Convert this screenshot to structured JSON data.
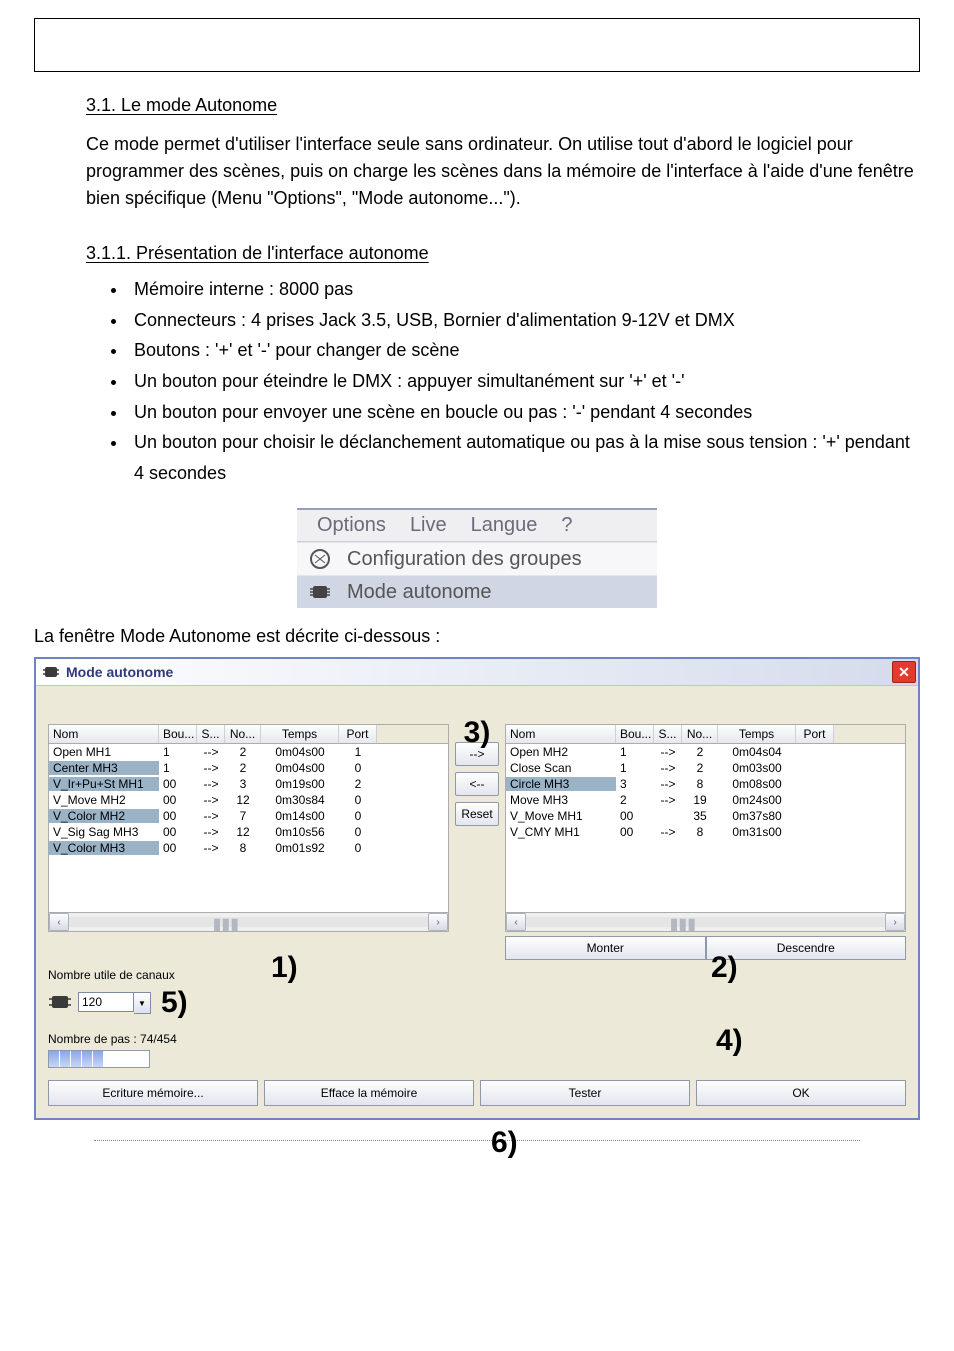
{
  "text": {
    "heading1": "3.1. Le mode Autonome",
    "para1": "Ce mode permet d'utiliser l'interface seule sans ordinateur. On utilise tout d'abord le logiciel pour programmer des scènes, puis on charge les scènes dans la mémoire de l'interface à l'aide d'une fenêtre bien spécifique (Menu \"Options\", \"Mode autonome...\").",
    "heading2": "3.1.1. Présentation de l'interface autonome",
    "li1": "Mémoire interne : 8000 pas",
    "li2": "Connecteurs : 4 prises Jack 3.5, USB, Bornier d'alimentation 9-12V et DMX",
    "li3": "Boutons : '+' et '-' pour changer de scène",
    "li4": "Un bouton pour éteindre le DMX : appuyer simultanément sur '+' et '-'",
    "li5": "Un bouton pour envoyer une scène en boucle ou pas : '-' pendant 4 secondes",
    "li6": "Un bouton pour choisir le déclanchement automatique ou pas à la mise sous tension : '+' pendant 4 secondes"
  },
  "menu": {
    "items": [
      "Options",
      "Live",
      "Langue",
      "?"
    ],
    "entry1": "Configuration des groupes",
    "entry2": "Mode autonome"
  },
  "caption": "La fenêtre Mode Autonome est décrite ci-dessous :",
  "window": {
    "title": "Mode autonome",
    "closeGlyph": "✕",
    "headers": [
      "Nom",
      "Bou...",
      "S...",
      "No...",
      "Temps",
      "Port"
    ],
    "leftRows": [
      {
        "nom": "Open MH1",
        "bou": "1",
        "s": "-->",
        "no": "2",
        "temps": "0m04s00",
        "port": "1",
        "sel": false
      },
      {
        "nom": "Center MH3",
        "bou": "1",
        "s": "-->",
        "no": "2",
        "temps": "0m04s00",
        "port": "0",
        "sel": true
      },
      {
        "nom": "V_Ir+Pu+St MH1",
        "bou": "00",
        "s": "-->",
        "no": "3",
        "temps": "0m19s00",
        "port": "2",
        "sel": true
      },
      {
        "nom": "V_Move MH2",
        "bou": "00",
        "s": "-->",
        "no": "12",
        "temps": "0m30s84",
        "port": "0",
        "sel": false
      },
      {
        "nom": "V_Color MH2",
        "bou": "00",
        "s": "-->",
        "no": "7",
        "temps": "0m14s00",
        "port": "0",
        "sel": true
      },
      {
        "nom": "V_Sig Sag MH3",
        "bou": "00",
        "s": "-->",
        "no": "12",
        "temps": "0m10s56",
        "port": "0",
        "sel": false
      },
      {
        "nom": "V_Color MH3",
        "bou": "00",
        "s": "-->",
        "no": "8",
        "temps": "0m01s92",
        "port": "0",
        "sel": true
      }
    ],
    "rightRows": [
      {
        "nom": "Open MH2",
        "bou": "1",
        "s": "-->",
        "no": "2",
        "temps": "0m04s04",
        "port": "",
        "sel": false
      },
      {
        "nom": "Close Scan",
        "bou": "1",
        "s": "-->",
        "no": "2",
        "temps": "0m03s00",
        "port": "",
        "sel": false
      },
      {
        "nom": "Circle MH3",
        "bou": "3",
        "s": "-->",
        "no": "8",
        "temps": "0m08s00",
        "port": "",
        "sel": true
      },
      {
        "nom": "Move MH3",
        "bou": "2",
        "s": "-->",
        "no": "19",
        "temps": "0m24s00",
        "port": "",
        "sel": false
      },
      {
        "nom": "V_Move MH1",
        "bou": "00",
        "s": "",
        "no": "35",
        "temps": "0m37s80",
        "port": "",
        "sel": false
      },
      {
        "nom": "V_CMY MH1",
        "bou": "00",
        "s": "-->",
        "no": "8",
        "temps": "0m31s00",
        "port": "",
        "sel": false
      }
    ],
    "midButtons": {
      "add": "-->",
      "remove": "<--",
      "reset": "Reset"
    },
    "move": {
      "up": "Monter",
      "down": "Descendre"
    },
    "channelsLabel": "Nombre utile de canaux",
    "channelsValue": "120",
    "stepsLabel": "Nombre de pas : 74/454",
    "bottom": {
      "write": "Ecriture mémoire...",
      "erase": "Efface la mémoire",
      "test": "Tester",
      "ok": "OK"
    },
    "scrollGlyphs": {
      "left": "‹",
      "right": "›",
      "track": "▮▮▮"
    },
    "dropdownGlyph": "▼"
  },
  "markers": {
    "m1": "1)",
    "m2": "2)",
    "m3": "3)",
    "m4": "4)",
    "m5": "5)",
    "m6": "6)"
  }
}
